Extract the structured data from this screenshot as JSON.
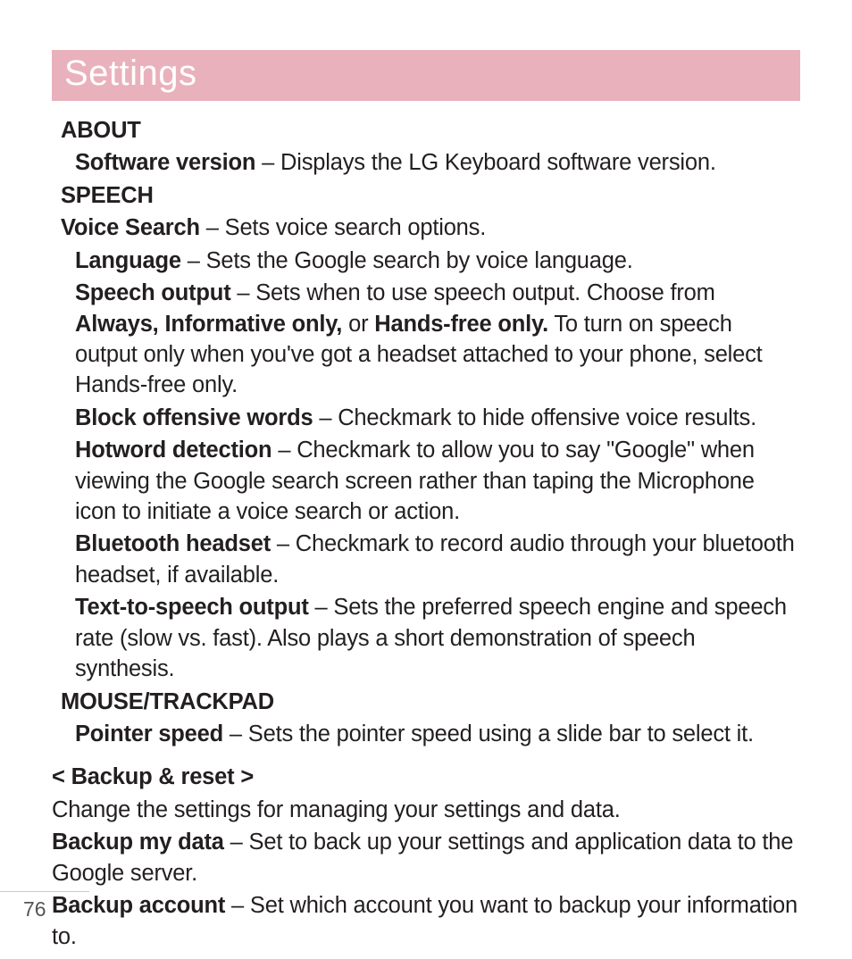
{
  "title": "Settings",
  "about": {
    "heading": "ABOUT",
    "software_version_label": "Software version",
    "software_version_desc": " – Displays the LG Keyboard software version."
  },
  "speech": {
    "heading": "SPEECH",
    "voice_search_label": "Voice Search",
    "voice_search_desc": " – Sets voice search options.",
    "language_label": "Language",
    "language_desc": " – Sets the Google search by voice language.",
    "speech_output_label": "Speech output",
    "speech_output_lead": " – Sets when to use speech output. Choose from ",
    "opt_always": "Always, Informative only,",
    "opt_or": " or ",
    "opt_handsfree": "Hands-free only.",
    "speech_output_tail": " To turn on speech output only when you've got a headset attached to your phone, select Hands-free only.",
    "block_offensive_label": "Block offensive words",
    "block_offensive_desc": " – Checkmark to hide offensive voice results.",
    "hotword_label": "Hotword detection",
    "hotword_desc": " – Checkmark to allow you to say \"Google\" when viewing the Google search screen rather than taping the Microphone icon to initiate a voice search or action.",
    "bluetooth_label": "Bluetooth headset",
    "bluetooth_desc": " – Checkmark to record audio through your bluetooth headset, if available.",
    "tts_label": "Text-to-speech output",
    "tts_desc": " – Sets the preferred speech engine and speech rate (slow vs. fast). Also plays a short demonstration of speech synthesis."
  },
  "mouse": {
    "heading": "MOUSE/TRACKPAD",
    "pointer_label": "Pointer speed",
    "pointer_desc": " – Sets the pointer speed using a slide bar to select it."
  },
  "backup": {
    "heading": "< Backup & reset >",
    "intro": "Change the settings for managing your settings and data.",
    "my_data_label": "Backup my data",
    "my_data_desc": " – Set to back up your settings and application data to the Google server.",
    "account_label": "Backup account",
    "account_desc": " – Set which account you want to backup your information to."
  },
  "page_number": "76"
}
